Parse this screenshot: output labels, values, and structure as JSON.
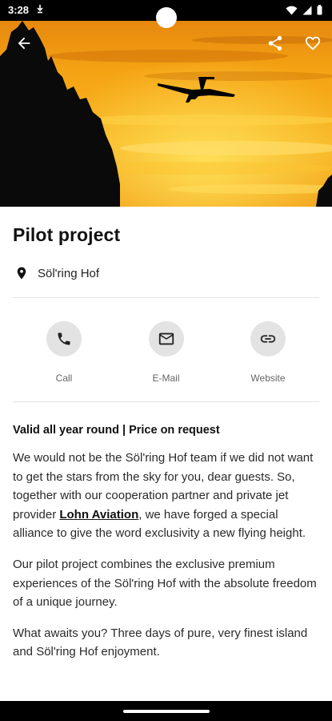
{
  "status_bar": {
    "time": "3:28",
    "download_icon": "download-icon",
    "icons": [
      "wifi-icon",
      "signal-icon",
      "battery-icon"
    ]
  },
  "header": {
    "back_icon": "back-arrow-icon",
    "share_icon": "share-icon",
    "favorite_icon": "heart-icon"
  },
  "offer": {
    "title": "Pilot project",
    "location": "Söl'ring Hof"
  },
  "actions": [
    {
      "label": "Call",
      "icon": "phone-icon"
    },
    {
      "label": "E-Mail",
      "icon": "mail-icon"
    },
    {
      "label": "Website",
      "icon": "link-icon"
    }
  ],
  "details": {
    "validity": "Valid all year round | Price on request",
    "para1_before": "We would not be the Söl'ring Hof team if we did not want to get the stars from the sky for you, dear guests. So, together with our cooperation partner and private jet provider ",
    "para1_link": "Lohn Aviation",
    "para1_after": ", we have forged a special alliance to give the word exclusivity a new flying height.",
    "para2": "Our pilot project combines the exclusive premium experiences of the Söl'ring Hof with the absolute freedom of a unique journey.",
    "para3": "What awaits you? Three days of pure, very finest island and Söl'ring Hof enjoyment."
  },
  "colors": {
    "accent": "#000000",
    "action_circle": "#e3e3e3",
    "sky_top": "#f39a12",
    "sky_glow": "#ffd23a"
  }
}
